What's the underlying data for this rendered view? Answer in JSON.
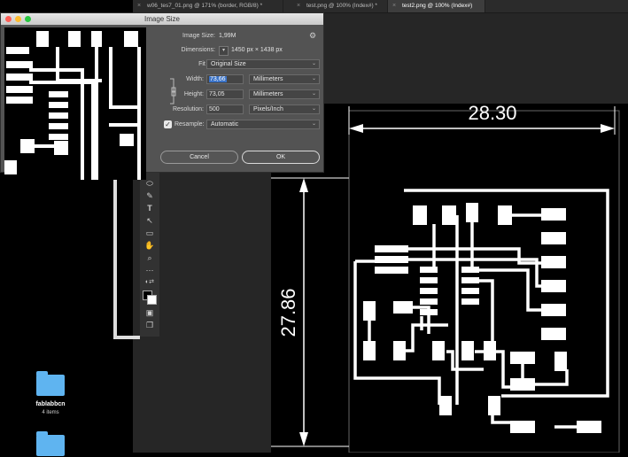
{
  "tabs": [
    {
      "label": "w06_tes7_01.png @ 171% (border, RGB/8) *",
      "active": false
    },
    {
      "label": "test.png @ 100% (Index#) *",
      "active": false
    },
    {
      "label": "test2.png @ 100% (Index#)",
      "active": true
    }
  ],
  "dialog": {
    "title": "Image Size",
    "image_size_label": "Image Size:",
    "image_size_value": "1,99M",
    "dimensions_label": "Dimensions:",
    "dimensions_value": "1450 px  ×  1438 px",
    "fit_to_label": "Fit To:",
    "fit_to_value": "Original Size",
    "width_label": "Width:",
    "width_value": "73,66",
    "width_unit": "Millimeters",
    "height_label": "Height:",
    "height_value": "73,05",
    "height_unit": "Millimeters",
    "resolution_label": "Resolution:",
    "resolution_value": "500",
    "resolution_unit": "Pixels/Inch",
    "resample_label": "Resample:",
    "resample_checked": true,
    "resample_value": "Automatic",
    "cancel_label": "Cancel",
    "ok_label": "OK"
  },
  "canvas": {
    "width_measure": "28.30",
    "height_measure": "27.86"
  },
  "desktop": {
    "folder_name": "fablabbcn",
    "folder_count": "4 items"
  },
  "colors": {
    "dialog_bg": "#535353",
    "selection": "#3b73c7",
    "folder": "#5fb4f0",
    "traffic_close": "#ff5f57",
    "traffic_min": "#febc2e",
    "traffic_max": "#28c840"
  }
}
